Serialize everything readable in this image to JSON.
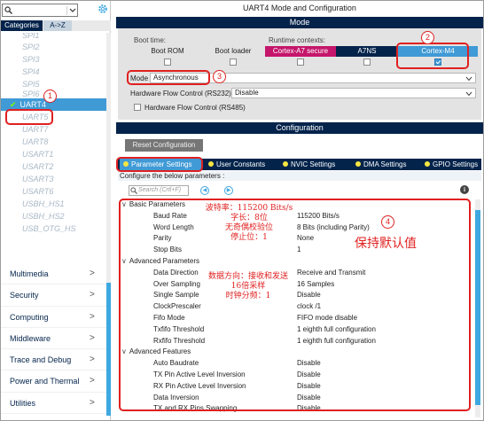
{
  "left": {
    "search_value": "",
    "tabs": {
      "categories": "Categories",
      "az": "A->Z"
    },
    "peripherals": [
      "SPI1",
      "SPI2",
      "SPI3",
      "SPI4",
      "SPI5",
      "SPI6",
      "UART4",
      "UART5",
      "UART7",
      "UART8",
      "USART1",
      "USART2",
      "USART3",
      "USART6",
      "USBH_HS1",
      "USBH_HS2",
      "USB_OTG_HS"
    ],
    "selected_check": "✔",
    "categories": [
      "Multimedia",
      "Security",
      "Computing",
      "Middleware",
      "Trace and Debug",
      "Power and Thermal",
      "Utilities"
    ]
  },
  "right": {
    "title": "UART4 Mode and Configuration",
    "mode_header": "Mode",
    "boot_time_label": "Boot time:",
    "runtime_label": "Runtime contexts:",
    "columns": [
      "Boot ROM",
      "Boot loader",
      "Cortex-A7 secure",
      "A7NS",
      "Cortex-M4"
    ],
    "column_checked": [
      false,
      false,
      false,
      false,
      true
    ],
    "column_colors": [
      "#e3e3e3",
      "#e3e3e3",
      "#c4166b",
      "#03234b",
      "#3f9ad6"
    ],
    "mode_label": "Mode",
    "mode_value": "Asynchronous",
    "hwflow_label": "Hardware Flow Control (RS232)",
    "hwflow_value": "Disable",
    "rs485_label": "Hardware Flow Control (RS485)",
    "config_header": "Configuration",
    "reset_label": "Reset Configuration",
    "config_tabs": [
      "Parameter Settings",
      "User Constants",
      "NVIC Settings",
      "DMA Settings",
      "GPIO Settings"
    ],
    "configure_text": "Configure the below parameters :",
    "search_placeholder": "Search (Crtl+F)",
    "info_icon": "i",
    "groups": [
      {
        "name": "Basic Parameters",
        "params": [
          {
            "name": "Baud Rate",
            "value": "115200 Bits/s"
          },
          {
            "name": "Word Length",
            "value": "8 Bits (including Parity)"
          },
          {
            "name": "Parity",
            "value": "None"
          },
          {
            "name": "Stop Bits",
            "value": "1"
          }
        ]
      },
      {
        "name": "Advanced Parameters",
        "params": [
          {
            "name": "Data Direction",
            "value": "Receive and Transmit"
          },
          {
            "name": "Over Sampling",
            "value": "16 Samples"
          },
          {
            "name": "Single Sample",
            "value": "Disable"
          },
          {
            "name": "ClockPrescaler",
            "value": "clock /1"
          },
          {
            "name": "Fifo Mode",
            "value": "FIFO mode disable"
          },
          {
            "name": "Txfifo Threshold",
            "value": "1 eighth full configuration"
          },
          {
            "name": "Rxfifo Threshold",
            "value": "1 eighth full configuration"
          }
        ]
      },
      {
        "name": "Advanced Features",
        "params": [
          {
            "name": "Auto Baudrate",
            "value": "Disable"
          },
          {
            "name": "TX Pin Active Level Inversion",
            "value": "Disable"
          },
          {
            "name": "RX Pin Active Level Inversion",
            "value": "Disable"
          },
          {
            "name": "Data Inversion",
            "value": "Disable"
          },
          {
            "name": "TX and RX Pins Swapping",
            "value": "Disable"
          }
        ]
      }
    ]
  },
  "annotations": {
    "markers": [
      "1",
      "2",
      "3",
      "4"
    ],
    "note_basic": [
      "波特率：115200 Bits/s",
      "字长：8位",
      "无奇偶校验位",
      "停止位：1"
    ],
    "note_advanced": [
      "数据方向：接收和发送",
      "16倍采样",
      "时钟分频：1"
    ],
    "note_keep": "保持默认值",
    "color": "#e02020"
  }
}
